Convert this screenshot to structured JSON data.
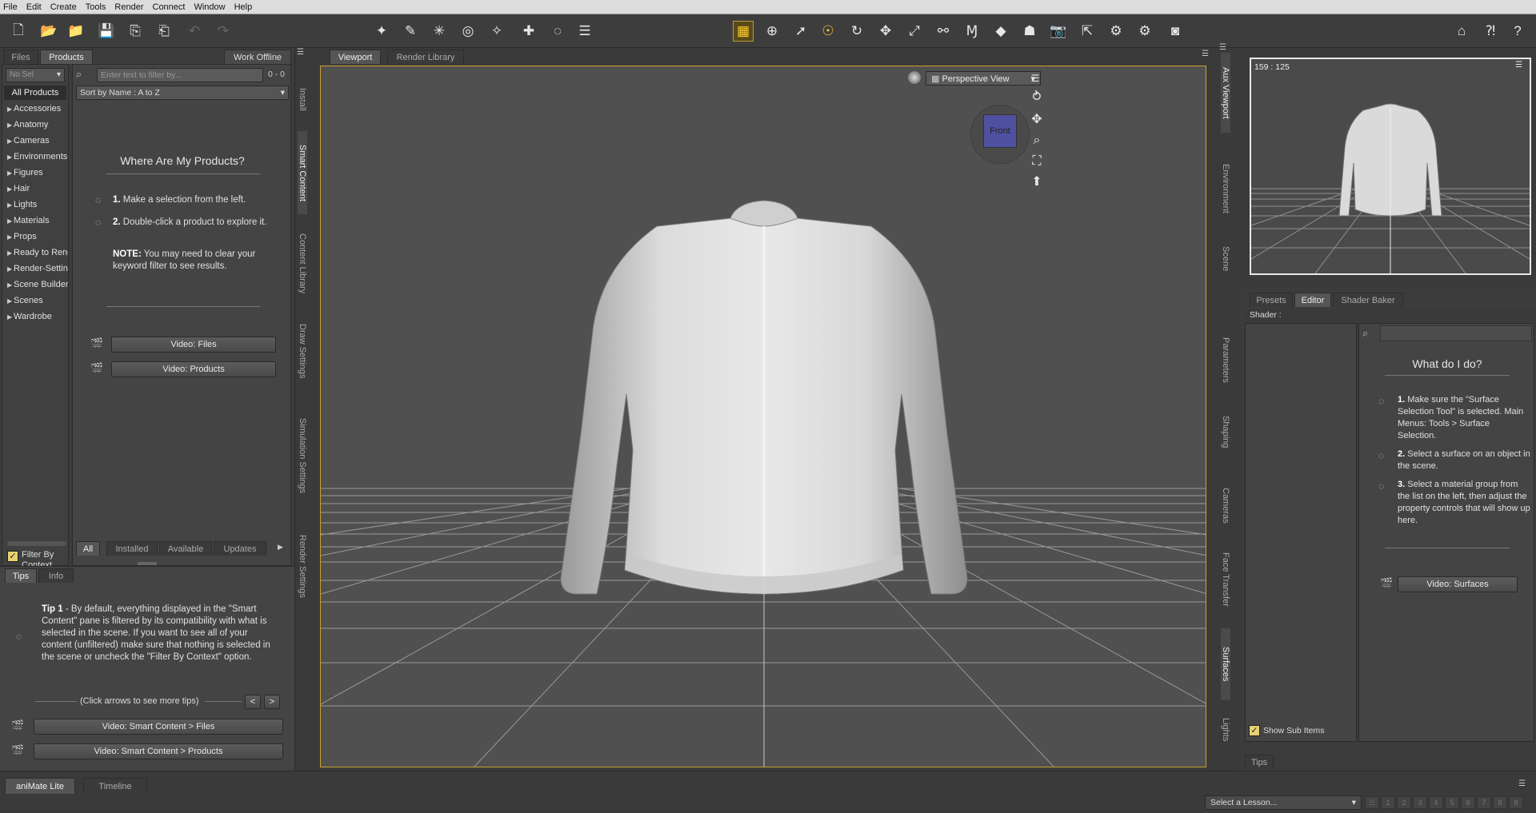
{
  "menu": [
    "File",
    "Edit",
    "Create",
    "Tools",
    "Render",
    "Connect",
    "Window",
    "Help"
  ],
  "left_panel": {
    "tabs": [
      "Files",
      "Products"
    ],
    "work_offline": "Work Offline",
    "filter_placeholder": "Enter text to filter by...",
    "count": "0 - 0",
    "sort": "Sort by Name : A to Z",
    "dropdown": "No Sel",
    "all_products": "All Products",
    "categories": [
      "Accessories",
      "Anatomy",
      "Cameras",
      "Environments",
      "Figures",
      "Hair",
      "Lights",
      "Materials",
      "Props",
      "Ready to Rend",
      "Render-Settin",
      "Scene Builder",
      "Scenes",
      "Wardrobe"
    ],
    "where_title": "Where Are My Products?",
    "step1": "Make a selection from the left.",
    "step2": "Double-click a product to explore it.",
    "step1_num": "1.",
    "step2_num": "2.",
    "note_label": "NOTE:",
    "note_text": "You may need to clear your keyword filter to see results.",
    "video_files": "Video: Files",
    "video_products": "Video: Products",
    "filter_by_context": "Filter By Context",
    "bottom_tabs": [
      "All",
      "Installed",
      "Available",
      "Updates"
    ],
    "side_tabs": [
      "Install",
      "Smart Content",
      "Content Library",
      "Draw Settings",
      "Simulation Settings",
      "Render Settings"
    ]
  },
  "tips_panel": {
    "tabs": [
      "Tips",
      "Info"
    ],
    "tip_label": "Tip 1",
    "tip_text": "- By default, everything displayed in the \"Smart Content\" pane is filtered by its compatibility with what is selected in the scene. If you want to see all of your content (unfiltered) make sure that nothing is selected in the scene or uncheck the \"Filter By Context\" option.",
    "arrows_hint": "(Click arrows to see more tips)",
    "prev": "<",
    "next": ">",
    "video1": "Video: Smart Content > Files",
    "video2": "Video: Smart Content > Products"
  },
  "viewport": {
    "tabs": [
      "Viewport",
      "Render Library"
    ],
    "view_select": "Perspective View",
    "cube_label": "Front"
  },
  "aux": {
    "coords": "159 : 125",
    "side_tabs": [
      "Aux Viewport",
      "Environment",
      "Scene"
    ]
  },
  "surfaces": {
    "tabs": [
      "Presets",
      "Editor",
      "Shader Baker"
    ],
    "shader_label": "Shader :",
    "what_title": "What do I do?",
    "step1_num": "1.",
    "step1": "Make sure the \"Surface Selection Tool\" is selected. Main Menus: Tools > Surface Selection.",
    "step2_num": "2.",
    "step2": "Select a surface on an object in the scene.",
    "step3_num": "3.",
    "step3": "Select a material group from the list on the left, then adjust the property controls that will show up here.",
    "video": "Video: Surfaces",
    "show_sub_items": "Show Sub Items",
    "tips_tab": "Tips",
    "side_tabs": [
      "Parameters",
      "Shaping",
      "Cameras",
      "Face Transfer",
      "Surfaces",
      "Lights"
    ]
  },
  "bottom": {
    "tabs": [
      "aniMate Lite",
      "Timeline"
    ],
    "lesson": "Select a Lesson...",
    "lesson_steps": [
      "1",
      "2",
      "3",
      "4",
      "5",
      "6",
      "7",
      "8",
      "9"
    ]
  },
  "colors": {
    "viewport_bg": "#505050",
    "accent": "#c8a030",
    "panel": "#444444"
  }
}
